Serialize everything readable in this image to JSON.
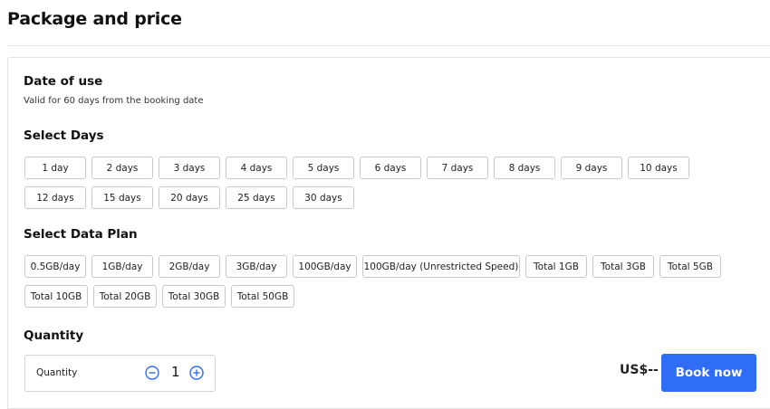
{
  "page": {
    "title": "Package and price"
  },
  "date_of_use": {
    "title": "Date of use",
    "note": "Valid for 60 days from the booking date"
  },
  "select_days": {
    "title": "Select Days",
    "options": [
      "1 day",
      "2 days",
      "3 days",
      "4 days",
      "5 days",
      "6 days",
      "7 days",
      "8 days",
      "9 days",
      "10 days",
      "12 days",
      "15 days",
      "20 days",
      "25 days",
      "30 days"
    ]
  },
  "select_data_plan": {
    "title": "Select Data Plan",
    "options": [
      "0.5GB/day",
      "1GB/day",
      "2GB/day",
      "3GB/day",
      "100GB/day",
      "100GB/day (Unrestricted Speed)",
      "Total 1GB",
      "Total 3GB",
      "Total 5GB",
      "Total 10GB",
      "Total 20GB",
      "Total 30GB",
      "Total 50GB"
    ]
  },
  "quantity": {
    "title": "Quantity",
    "label": "Quantity",
    "value": "1",
    "minus_icon": "minus-circle-icon",
    "plus_icon": "plus-circle-icon"
  },
  "price": {
    "text": "US$--"
  },
  "book": {
    "label": "Book now"
  },
  "colors": {
    "accent": "#2f6df6",
    "border": "#c9c9c9"
  }
}
